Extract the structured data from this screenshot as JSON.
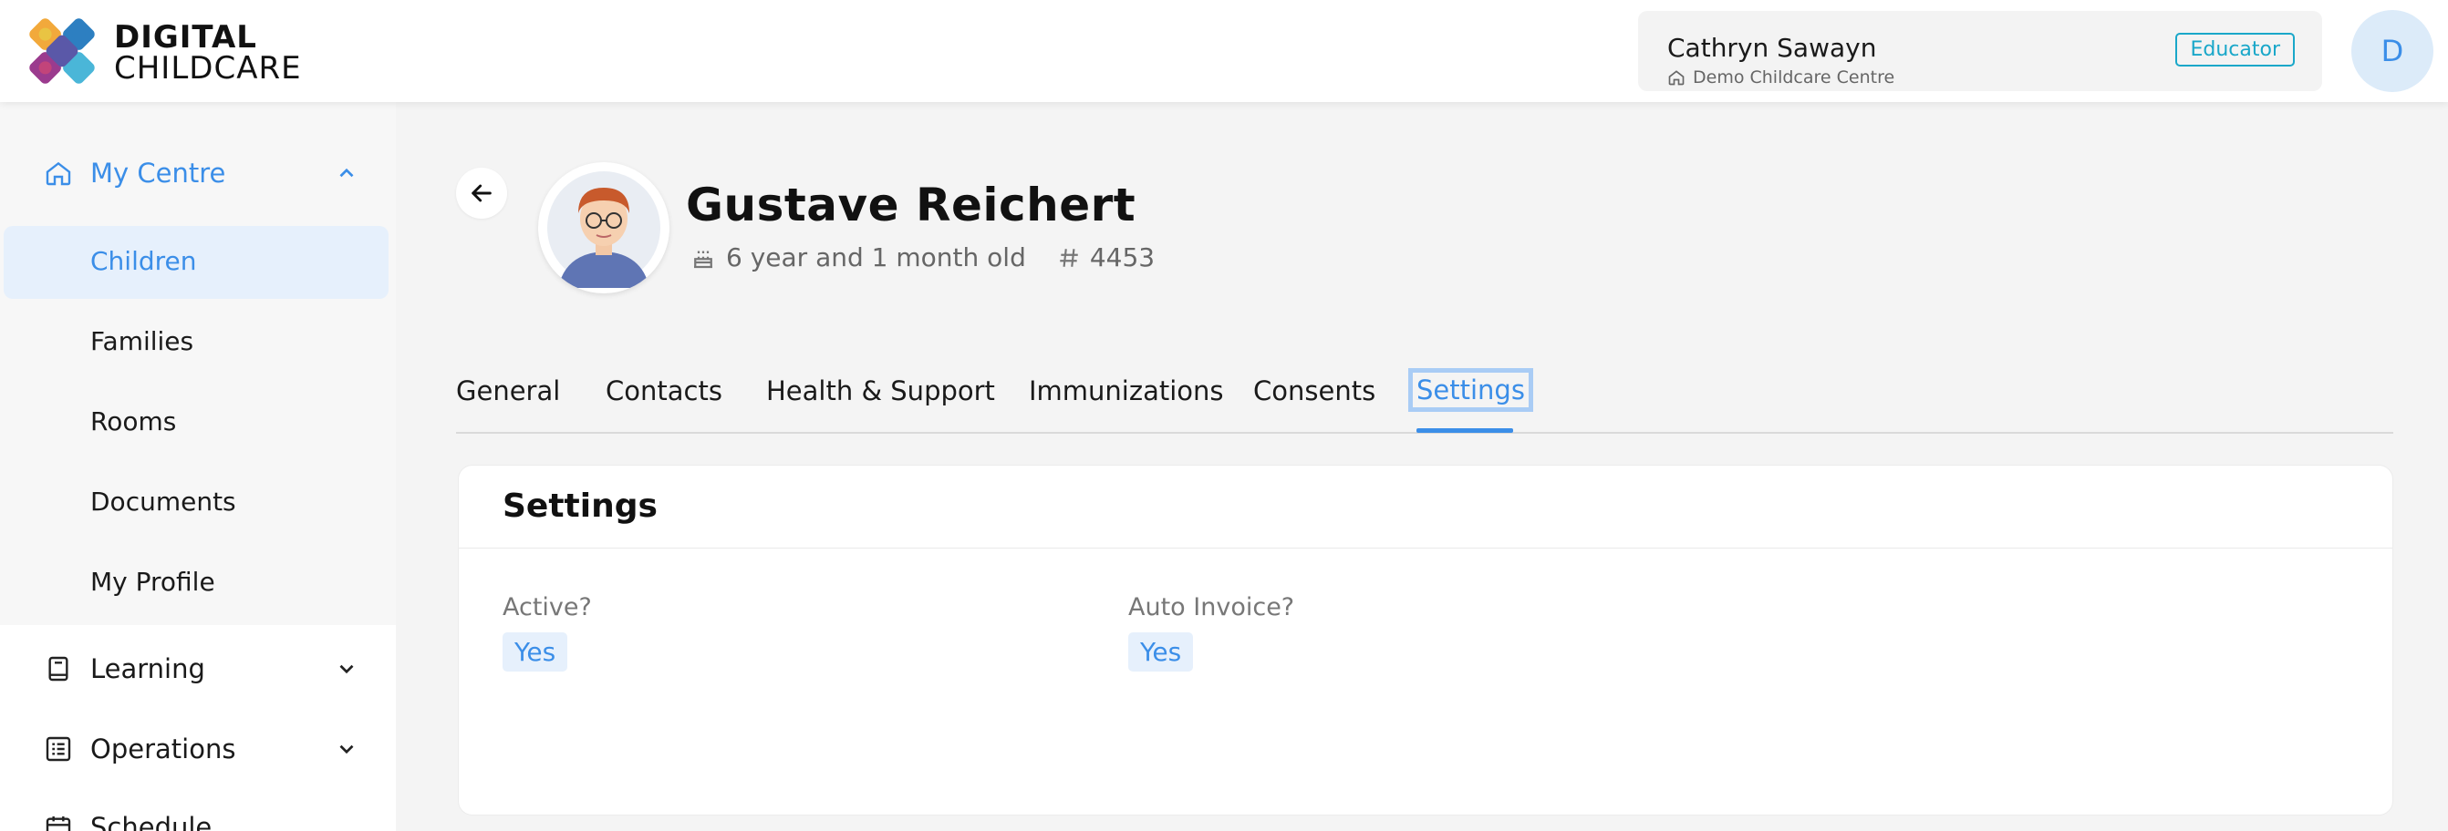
{
  "brand": {
    "line1": "DIGITAL",
    "line2": "CHILDCARE"
  },
  "user": {
    "name": "Cathryn Sawayn",
    "centre": "Demo Childcare Centre",
    "role": "Educator",
    "avatar_initial": "D"
  },
  "sidebar": {
    "my_centre": {
      "label": "My Centre",
      "items": [
        {
          "label": "Children",
          "active": true
        },
        {
          "label": "Families"
        },
        {
          "label": "Rooms"
        },
        {
          "label": "Documents"
        },
        {
          "label": "My Profile"
        }
      ]
    },
    "learning": {
      "label": "Learning"
    },
    "operations": {
      "label": "Operations"
    },
    "schedule": {
      "label": "Schedule"
    }
  },
  "child": {
    "name": "Gustave Reichert",
    "age": "6 year and 1 month old",
    "id": "4453"
  },
  "tabs": [
    {
      "label": "General"
    },
    {
      "label": "Contacts"
    },
    {
      "label": "Health & Support"
    },
    {
      "label": "Immunizations"
    },
    {
      "label": "Consents"
    },
    {
      "label": "Settings",
      "active": true
    }
  ],
  "settings": {
    "title": "Settings",
    "active_label": "Active?",
    "active_value": "Yes",
    "auto_invoice_label": "Auto Invoice?",
    "auto_invoice_value": "Yes"
  },
  "colors": {
    "accent": "#3b8ee8",
    "role_badge": "#19a7c9",
    "active_bg": "#e6f0fc"
  }
}
